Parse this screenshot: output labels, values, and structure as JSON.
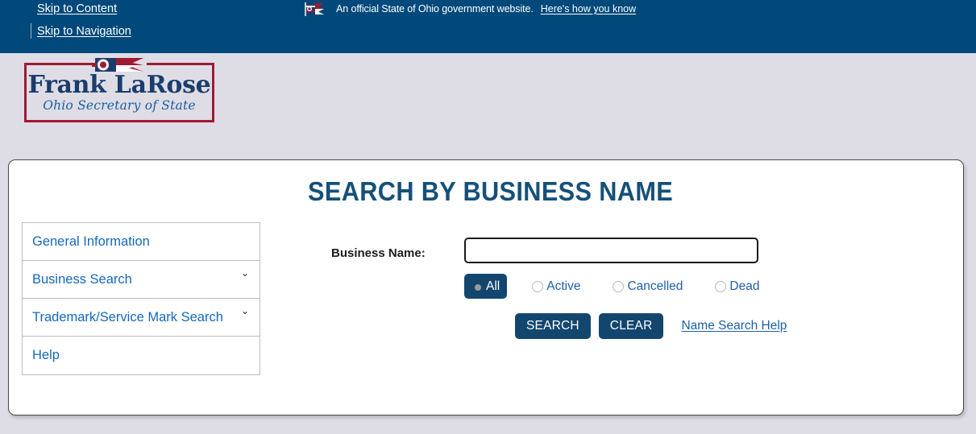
{
  "banner": {
    "skip_to_content": "Skip to Content",
    "skip_to_navigation": "Skip to Navigation",
    "official_text": "An official State of Ohio government website.",
    "official_link": "Here's how you know",
    "flag_icon": "ohio-flag-icon",
    "background_color": "#00497a"
  },
  "logo": {
    "name": "Frank LaRose",
    "subtitle": "Ohio Secretary of State",
    "frame_color": "#9e1b32",
    "name_color": "#1b3d6d",
    "flag_icon": "ohio-flag-icon"
  },
  "page": {
    "title": "SEARCH BY BUSINESS NAME",
    "title_color": "#155079",
    "background_color": "#dedde6"
  },
  "nav": {
    "items": [
      {
        "label": "General Information",
        "chevron": ""
      },
      {
        "label": "Business Search",
        "chevron": "⌄"
      },
      {
        "label": "Trademark/Service Mark Search",
        "chevron": "⌄"
      },
      {
        "label": "Help",
        "chevron": ""
      }
    ]
  },
  "form": {
    "business_name_label": "Business Name:",
    "business_name_value": "",
    "business_name_placeholder": "",
    "status_options": [
      {
        "label": "All",
        "selected": true
      },
      {
        "label": "Active",
        "selected": false
      },
      {
        "label": "Cancelled",
        "selected": false
      },
      {
        "label": "Dead",
        "selected": false
      }
    ],
    "search_button": "SEARCH",
    "clear_button": "CLEAR",
    "help_link": "Name Search Help",
    "button_color": "#12466f",
    "link_color": "#1e5fa8"
  }
}
